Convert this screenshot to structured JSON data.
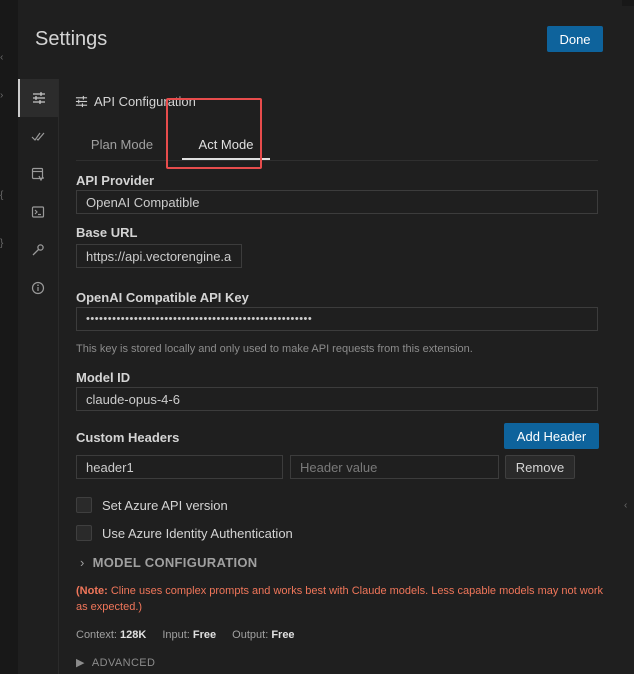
{
  "header": {
    "title": "Settings",
    "done_label": "Done"
  },
  "sidebar": {
    "items": [
      {
        "icon": "sliders-icon",
        "active": true
      },
      {
        "icon": "check-double-icon",
        "active": false
      },
      {
        "icon": "browser-icon",
        "active": false
      },
      {
        "icon": "terminal-icon",
        "active": false
      },
      {
        "icon": "wrench-icon",
        "active": false
      },
      {
        "icon": "info-icon",
        "active": false
      }
    ]
  },
  "section": {
    "title": "API Configuration",
    "icon": "sliders-icon"
  },
  "tabs": [
    {
      "label": "Plan Mode",
      "active": false
    },
    {
      "label": "Act Mode",
      "active": true
    }
  ],
  "form": {
    "api_provider": {
      "label": "API Provider",
      "value": "OpenAI Compatible"
    },
    "base_url": {
      "label": "Base URL",
      "value": "https://api.vectorengine.a"
    },
    "api_key": {
      "label": "OpenAI Compatible API Key",
      "value": "••••••••••••••••••••••••••••••••••••••••••••••••••••",
      "helper": "This key is stored locally and only used to make API requests from this extension."
    },
    "model_id": {
      "label": "Model ID",
      "value": "claude-opus-4-6"
    },
    "custom_headers": {
      "label": "Custom Headers",
      "add_label": "Add Header",
      "name_value": "header1",
      "value_placeholder": "Header value",
      "remove_label": "Remove"
    },
    "checkboxes": [
      {
        "label": "Set Azure API version",
        "checked": false
      },
      {
        "label": "Use Azure Identity Authentication",
        "checked": false
      }
    ]
  },
  "model_config": {
    "label": "MODEL CONFIGURATION",
    "note_prefix": "(Note:",
    "note_text": " Cline uses complex prompts and works best with Claude models. Less capable models may not work as expected.)"
  },
  "stats": {
    "context_label": "Context:",
    "context_value": "128K",
    "input_label": "Input:",
    "input_value": "Free",
    "output_label": "Output:",
    "output_value": "Free"
  },
  "advanced": {
    "label": "ADVANCED"
  },
  "colors": {
    "accent": "#0e639c",
    "highlight": "#e74c4c",
    "note": "#f0765a",
    "background": "#1f1f1f"
  }
}
